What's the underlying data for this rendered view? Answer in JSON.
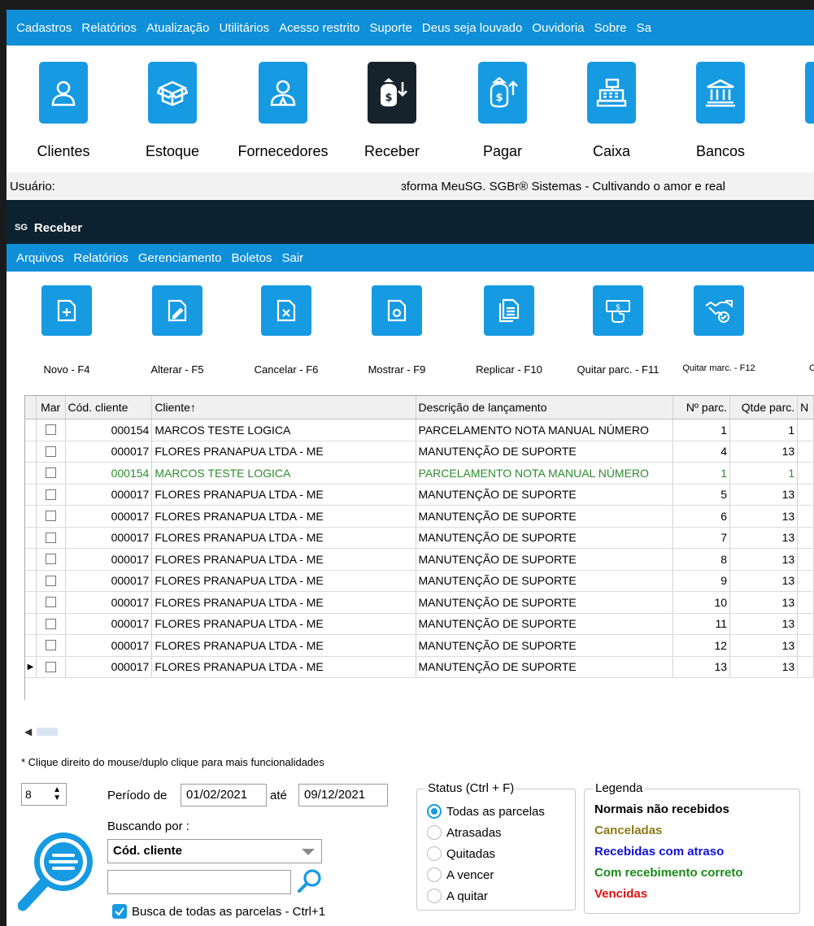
{
  "main_menu": [
    "Cadastros",
    "Relatórios",
    "Atualização",
    "Utilitários",
    "Acesso restrito",
    "Suporte",
    "Deus seja louvado",
    "Ouvidoria",
    "Sobre",
    "Sa"
  ],
  "main_toolbar": [
    {
      "label": "Clientes",
      "icon": "user-icon"
    },
    {
      "label": "Estoque",
      "icon": "box-icon"
    },
    {
      "label": "Fornecedores",
      "icon": "supplier-icon"
    },
    {
      "label": "Receber",
      "icon": "money-bag-down-icon"
    },
    {
      "label": "Pagar",
      "icon": "money-bag-up-icon"
    },
    {
      "label": "Caixa",
      "icon": "cash-register-icon"
    },
    {
      "label": "Bancos",
      "icon": "bank-icon"
    }
  ],
  "status": {
    "user_label": "Usuário:",
    "message": "ɜforma MeuSG. SGBr® Sistemas  - Cultivando o amor e real"
  },
  "child": {
    "logo": "SG",
    "title": "Receber",
    "menu": [
      "Arquivos",
      "Relatórios",
      "Gerenciamento",
      "Boletos",
      "Sair"
    ]
  },
  "toolbar": [
    {
      "label": "Novo - F4",
      "icon": "new-file-icon"
    },
    {
      "label": "Alterar - F5",
      "icon": "edit-file-icon"
    },
    {
      "label": "Cancelar - F6",
      "icon": "cancel-file-icon"
    },
    {
      "label": "Mostrar - F9",
      "icon": "view-file-icon"
    },
    {
      "label": "Replicar - F10",
      "icon": "copy-file-icon"
    },
    {
      "label": "Quitar parc. - F11",
      "icon": "cash-payment-icon"
    },
    {
      "label": "Quitar marc. - F12",
      "icon": "handshake-check-icon"
    },
    {
      "label": "C",
      "icon": ""
    }
  ],
  "grid": {
    "columns": [
      "Mar",
      "Cód. cliente",
      "Cliente↑",
      "Descrição de lançamento",
      "Nº parc.",
      "Qtde parc.",
      "N"
    ],
    "rows": [
      {
        "cod": "000154",
        "cliente": "MARCOS TESTE LOGICA",
        "descricao": "PARCELAMENTO NOTA MANUAL NÚMERO",
        "nparc": "1",
        "qtde": "1",
        "style": "normal"
      },
      {
        "cod": "000017",
        "cliente": "FLORES PRANAPUA LTDA - ME",
        "descricao": "MANUTENÇÃO DE SUPORTE",
        "nparc": "4",
        "qtde": "13",
        "style": "normal"
      },
      {
        "cod": "000154",
        "cliente": "MARCOS TESTE LOGICA",
        "descricao": "PARCELAMENTO NOTA MANUAL NÚMERO",
        "nparc": "1",
        "qtde": "1",
        "style": "green"
      },
      {
        "cod": "000017",
        "cliente": "FLORES PRANAPUA LTDA - ME",
        "descricao": "MANUTENÇÃO DE SUPORTE",
        "nparc": "5",
        "qtde": "13",
        "style": "normal"
      },
      {
        "cod": "000017",
        "cliente": "FLORES PRANAPUA LTDA - ME",
        "descricao": "MANUTENÇÃO DE SUPORTE",
        "nparc": "6",
        "qtde": "13",
        "style": "normal"
      },
      {
        "cod": "000017",
        "cliente": "FLORES PRANAPUA LTDA - ME",
        "descricao": "MANUTENÇÃO DE SUPORTE",
        "nparc": "7",
        "qtde": "13",
        "style": "normal"
      },
      {
        "cod": "000017",
        "cliente": "FLORES PRANAPUA LTDA - ME",
        "descricao": "MANUTENÇÃO DE SUPORTE",
        "nparc": "8",
        "qtde": "13",
        "style": "normal"
      },
      {
        "cod": "000017",
        "cliente": "FLORES PRANAPUA LTDA - ME",
        "descricao": "MANUTENÇÃO DE SUPORTE",
        "nparc": "9",
        "qtde": "13",
        "style": "normal"
      },
      {
        "cod": "000017",
        "cliente": "FLORES PRANAPUA LTDA - ME",
        "descricao": "MANUTENÇÃO DE SUPORTE",
        "nparc": "10",
        "qtde": "13",
        "style": "normal"
      },
      {
        "cod": "000017",
        "cliente": "FLORES PRANAPUA LTDA - ME",
        "descricao": "MANUTENÇÃO DE SUPORTE",
        "nparc": "11",
        "qtde": "13",
        "style": "normal"
      },
      {
        "cod": "000017",
        "cliente": "FLORES PRANAPUA LTDA - ME",
        "descricao": "MANUTENÇÃO DE SUPORTE",
        "nparc": "12",
        "qtde": "13",
        "style": "normal"
      },
      {
        "cod": "000017",
        "cliente": "FLORES PRANAPUA LTDA - ME",
        "descricao": "MANUTENÇÃO DE SUPORTE",
        "nparc": "13",
        "qtde": "13",
        "style": "normal",
        "current": true
      }
    ]
  },
  "filters": {
    "hint": "* Clique direito do mouse/duplo clique para mais funcionalidades",
    "spin_value": "8",
    "periodo_label": "Período de",
    "date_from": "01/02/2021",
    "ate_label": "até",
    "date_to": "09/12/2021",
    "busca_label": "Buscando por :",
    "busca_value": "Cód. cliente",
    "search_value": "",
    "all_parcels_label": "Busca de todas as parcelas - Ctrl+1"
  },
  "status_group": {
    "title": "Status (Ctrl + F)",
    "options": [
      "Todas as parcelas",
      "Atrasadas",
      "Quitadas",
      "A vencer",
      "A quitar"
    ],
    "selected": 0
  },
  "legend": {
    "title": "Legenda",
    "items": [
      {
        "label": "Normais não recebidos",
        "color": "#000000"
      },
      {
        "label": "Canceladas",
        "color": "#8b7a16"
      },
      {
        "label": "Recebidas com atraso",
        "color": "#1010d8"
      },
      {
        "label": "Com recebimento correto",
        "color": "#1a8a1a"
      },
      {
        "label": "Vencidas",
        "color": "#e01010"
      }
    ]
  },
  "colors": {
    "accent": "#169ae2",
    "menu": "#0f8fd8",
    "dark": "#0d2230"
  }
}
